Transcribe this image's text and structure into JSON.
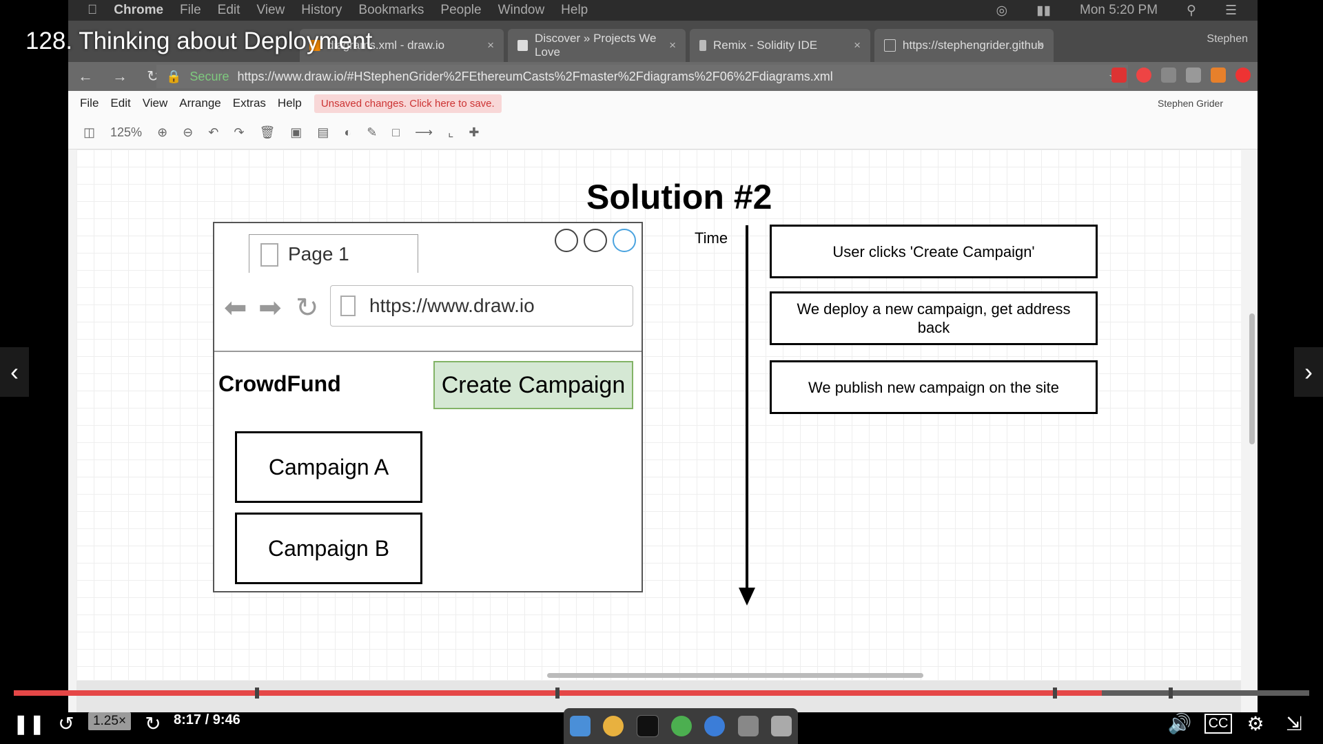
{
  "video": {
    "title": "128. Thinking about Deployment",
    "progress": 0.84,
    "speed_label": "1.25",
    "speed_suffix": "×",
    "time_label": "8:17 / 9:46",
    "cc_label": "CC"
  },
  "mac_menu": {
    "items": [
      "Chrome",
      "File",
      "Edit",
      "View",
      "History",
      "Bookmarks",
      "People",
      "Window",
      "Help"
    ],
    "clock": "Mon 5:20 PM"
  },
  "chrome": {
    "tabs": [
      {
        "label": "diagrams.xml - draw.io"
      },
      {
        "label": "Discover » Projects We Love"
      },
      {
        "label": "Remix - Solidity IDE"
      },
      {
        "label": "https://stephengrider.github"
      }
    ],
    "profile": "Stephen",
    "secure_label": "Secure",
    "url": "https://www.draw.io/#HStephenGrider%2FEthereumCasts%2Fmaster%2Fdiagrams%2F06%2Fdiagrams.xml"
  },
  "drawio": {
    "menu": [
      "File",
      "Edit",
      "View",
      "Arrange",
      "Extras",
      "Help"
    ],
    "unsaved": "Unsaved changes. Click here to save.",
    "user": "Stephen Grider",
    "zoom": "125%"
  },
  "diagram": {
    "title": "Solution #2",
    "page_tab": "Page 1",
    "browser_url": "https://www.draw.io",
    "brand": "CrowdFund",
    "create_button": "Create Campaign",
    "campaigns": [
      "Campaign A",
      "Campaign B"
    ],
    "time_label": "Time",
    "steps": [
      "User clicks 'Create Campaign'",
      "We deploy a new campaign, get address back",
      "We publish new campaign on the site"
    ]
  },
  "colors": {
    "progress_fill": "#e54747",
    "create_fill": "#d5e8d4",
    "create_border": "#82b366"
  }
}
